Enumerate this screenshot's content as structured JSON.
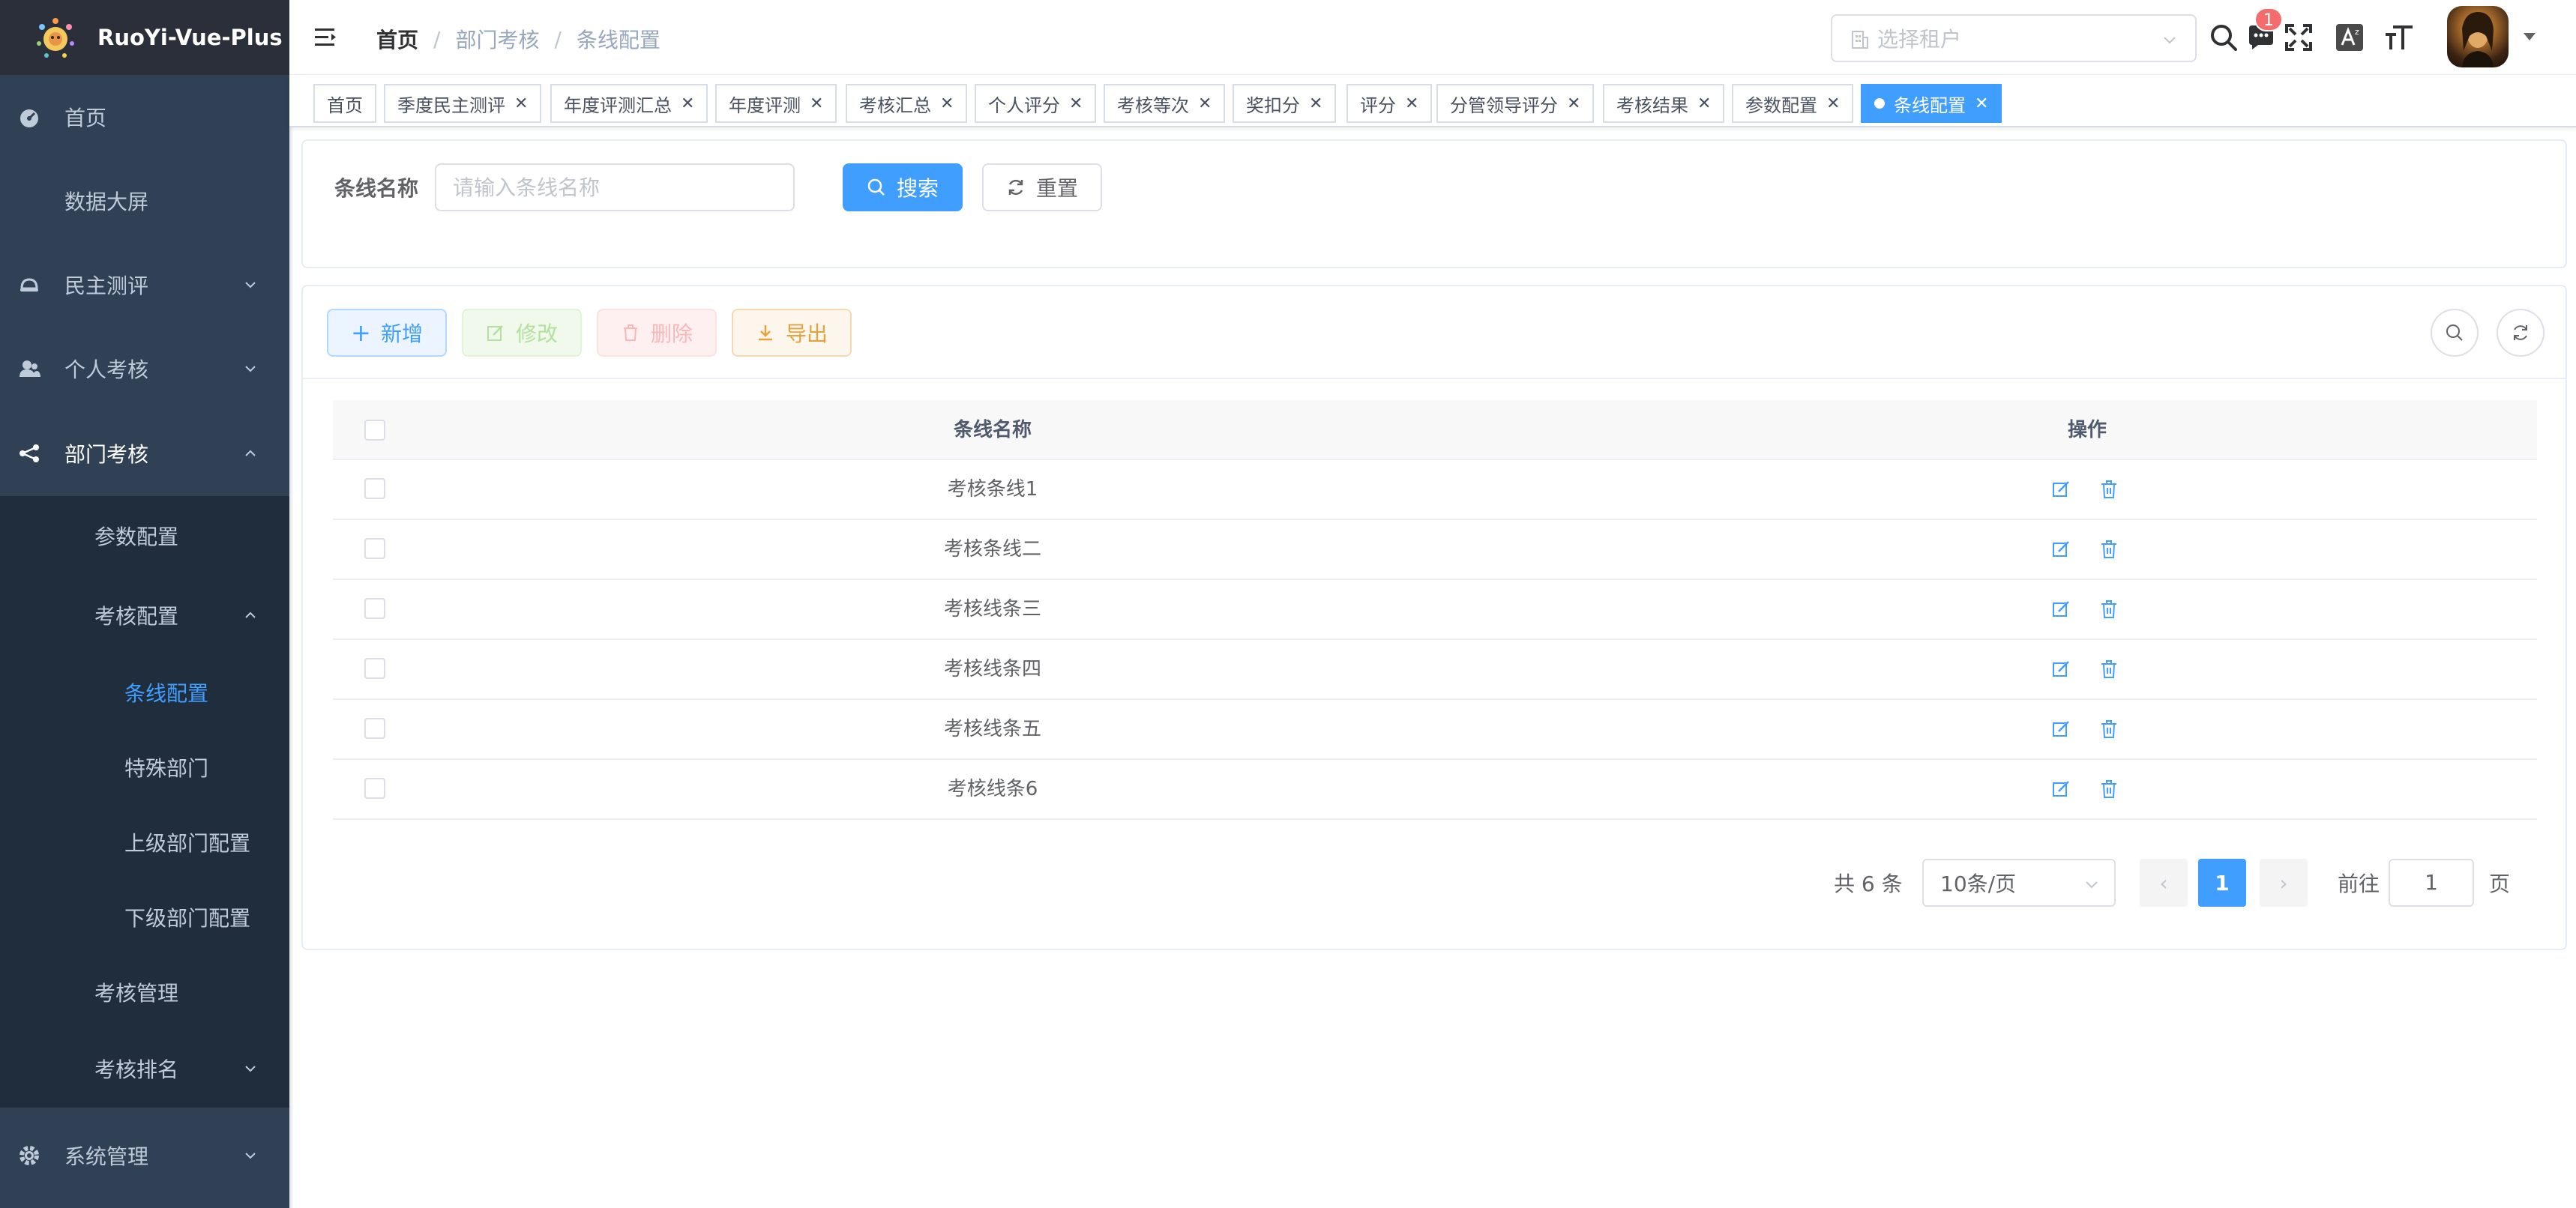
{
  "app": {
    "title": "RuoYi-Vue-Plus",
    "accent": "#409eff",
    "sidebar_bg": "#304156"
  },
  "sidebar": {
    "items": [
      {
        "label": "首页",
        "icon": "dashboard-icon"
      },
      {
        "label": "数据大屏"
      },
      {
        "label": "民主测评",
        "icon": "people-icon"
      },
      {
        "label": "个人考核",
        "icon": "user-icon"
      },
      {
        "label": "部门考核",
        "icon": "tree-icon"
      },
      {
        "label": "参数配置"
      },
      {
        "label": "考核配置"
      },
      {
        "label": "条线配置"
      },
      {
        "label": "特殊部门"
      },
      {
        "label": "上级部门配置"
      },
      {
        "label": "下级部门配置"
      },
      {
        "label": "考核管理"
      },
      {
        "label": "考核排名"
      },
      {
        "label": "系统管理",
        "icon": "gear-icon"
      }
    ]
  },
  "navbar": {
    "breadcrumb": [
      "首页",
      "部门考核",
      "条线配置"
    ],
    "tenant_placeholder": "选择租户",
    "message_count": "1"
  },
  "tags": [
    {
      "label": "首页"
    },
    {
      "label": "季度民主测评"
    },
    {
      "label": "年度评测汇总"
    },
    {
      "label": "年度评测"
    },
    {
      "label": "考核汇总"
    },
    {
      "label": "个人评分"
    },
    {
      "label": "考核等次"
    },
    {
      "label": "奖扣分"
    },
    {
      "label": "评分"
    },
    {
      "label": "分管领导评分"
    },
    {
      "label": "考核结果"
    },
    {
      "label": "参数配置"
    },
    {
      "label": "条线配置",
      "active": true
    }
  ],
  "search": {
    "label": "条线名称",
    "placeholder": "请输入条线名称",
    "value": "",
    "search_button": "搜索",
    "reset_button": "重置"
  },
  "toolbar": {
    "add": "新增",
    "edit": "修改",
    "delete": "删除",
    "export": "导出"
  },
  "table": {
    "columns": [
      "条线名称",
      "操作"
    ],
    "rows": [
      {
        "name": "考核条线1"
      },
      {
        "name": "考核条线二"
      },
      {
        "name": "考核线条三"
      },
      {
        "name": "考核线条四"
      },
      {
        "name": "考核线条五"
      },
      {
        "name": "考核线条6"
      }
    ]
  },
  "pagination": {
    "total_text": "共 6 条",
    "page_size": "10条/页",
    "current_page": "1",
    "goto_label": "前往",
    "goto_value": "1",
    "page_suffix": "页"
  }
}
